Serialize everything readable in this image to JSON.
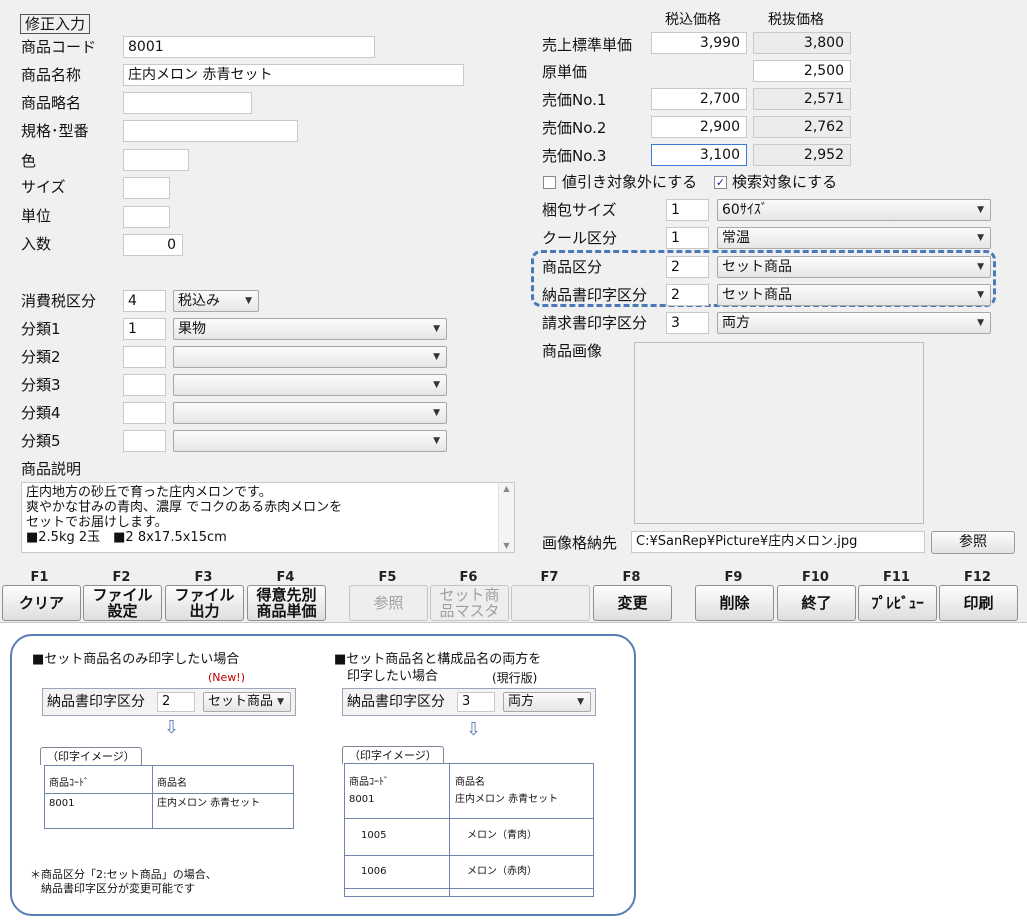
{
  "form": {
    "mode_label": "修正入力",
    "left_fields": {
      "code_label": "商品コード",
      "code_value": "8001",
      "name_label": "商品名称",
      "name_value": "庄内メロン 赤青セット",
      "short_name_label": "商品略名",
      "short_name_value": "",
      "spec_label": "規格･型番",
      "spec_value": "",
      "color_label": "色",
      "color_value": "",
      "size_label": "サイズ",
      "size_value": "",
      "unit_label": "単位",
      "unit_value": "",
      "qty_label": "入数",
      "qty_value": "0"
    },
    "tax": {
      "label": "消費税区分",
      "value": "4",
      "select": "税込み"
    },
    "categories": [
      {
        "label": "分類1",
        "value": "1",
        "select": "果物"
      },
      {
        "label": "分類2",
        "value": "",
        "select": ""
      },
      {
        "label": "分類3",
        "value": "",
        "select": ""
      },
      {
        "label": "分類4",
        "value": "",
        "select": ""
      },
      {
        "label": "分類5",
        "value": "",
        "select": ""
      }
    ],
    "description_label": "商品説明",
    "description_lines": [
      "庄内地方の砂丘で育った庄内メロンです。",
      "爽やかな甘みの青肉、濃厚 でコクのある赤肉メロンを",
      "セットでお届けします。",
      "■2.5kg 2玉　■2 8x17.5x15cm"
    ],
    "price_headers": {
      "with_tax": "税込価格",
      "without_tax": "税抜価格"
    },
    "prices": [
      {
        "label": "売上標準単価",
        "with_tax": "3,990",
        "without_tax": "3,800"
      },
      {
        "label": "原単価",
        "with_tax": null,
        "without_tax": "2,500"
      },
      {
        "label": "売価No.1",
        "with_tax": "2,700",
        "without_tax": "2,571"
      },
      {
        "label": "売価No.2",
        "with_tax": "2,900",
        "without_tax": "2,762"
      },
      {
        "label": "売価No.3",
        "with_tax": "3,100",
        "without_tax": "2,952"
      }
    ],
    "checkboxes": {
      "exclude_discount": {
        "label": "値引き対象外にする",
        "checked": false
      },
      "searchable": {
        "label": "検索対象にする",
        "checked": true
      }
    },
    "right_fields": [
      {
        "label": "梱包サイズ",
        "value": "1",
        "select": "60ｻｲｽﾞ"
      },
      {
        "label": "クール区分",
        "value": "1",
        "select": "常温"
      },
      {
        "label": "商品区分",
        "value": "2",
        "select": "セット商品"
      },
      {
        "label": "納品書印字区分",
        "value": "2",
        "select": "セット商品"
      },
      {
        "label": "請求書印字区分",
        "value": "3",
        "select": "両方"
      }
    ],
    "image_label": "商品画像",
    "image_path_label": "画像格納先",
    "image_path_value": "C:¥SanRep¥Picture¥庄内メロン.jpg",
    "browse_button": "参照"
  },
  "function_keys": [
    {
      "key": "F1",
      "label": "クリア",
      "enabled": true
    },
    {
      "key": "F2",
      "label": "ファイル\n設定",
      "enabled": true
    },
    {
      "key": "F3",
      "label": "ファイル\n出力",
      "enabled": true
    },
    {
      "key": "F4",
      "label": "得意先別\n商品単価",
      "enabled": true
    },
    {
      "key": "F5",
      "label": "参照",
      "enabled": false
    },
    {
      "key": "F6",
      "label": "セット商\n品マスタ",
      "enabled": false
    },
    {
      "key": "F7",
      "label": "",
      "enabled": false
    },
    {
      "key": "F8",
      "label": "変更",
      "enabled": true
    },
    {
      "key": "F9",
      "label": "削除",
      "enabled": true
    },
    {
      "key": "F10",
      "label": "終了",
      "enabled": true
    },
    {
      "key": "F11",
      "label": "ﾌﾟﾚﾋﾞｭｰ",
      "enabled": true
    },
    {
      "key": "F12",
      "label": "印刷",
      "enabled": true
    }
  ],
  "explanation": {
    "left": {
      "title": "■セット商品名のみ印字したい場合",
      "badge": "(New!)",
      "field_label": "納品書印字区分",
      "field_value": "2",
      "field_select": "セット商品",
      "arrow": "⇩",
      "tab": "（印字イメージ）",
      "col_code": "商品ｺｰﾄﾞ",
      "col_name": "商品名",
      "rows": [
        {
          "code": "8001",
          "name": "庄内メロン 赤青セット"
        }
      ],
      "note_1": "＊商品区分「2:セット商品」の場合、",
      "note_2": "　納品書印字区分が変更可能です"
    },
    "right": {
      "title_1": "■セット商品名と構成品名の両方を",
      "title_2": "　印字したい場合",
      "badge": "(現行版)",
      "field_label": "納品書印字区分",
      "field_value": "3",
      "field_select": "両方",
      "arrow": "⇩",
      "tab": "（印字イメージ）",
      "col_code": "商品ｺｰﾄﾞ",
      "col_name": "商品名",
      "rows": [
        {
          "code": "8001",
          "name": "庄内メロン 赤青セット"
        },
        {
          "code": "1005",
          "name": "メロン（青肉）"
        },
        {
          "code": "1006",
          "name": "メロン（赤肉）"
        }
      ]
    }
  },
  "colors": {
    "highlight_dash": "#4a78b8",
    "panel_border": "#5a7db5",
    "new_badge": "#c00000"
  }
}
